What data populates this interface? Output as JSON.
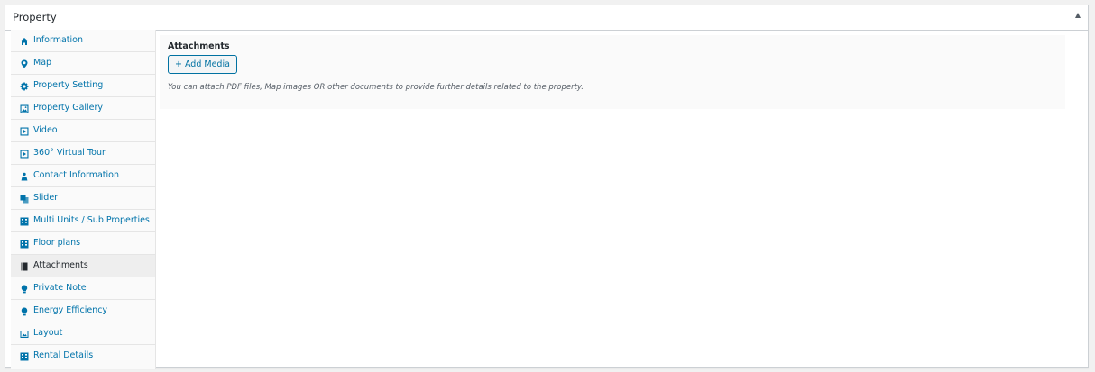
{
  "metabox": {
    "title": "Property",
    "toggle_icon": "arrow-up-icon"
  },
  "tabs": [
    {
      "label": "Information",
      "icon": "home-icon",
      "active": false
    },
    {
      "label": "Map",
      "icon": "location-pin-icon",
      "active": false
    },
    {
      "label": "Property Setting",
      "icon": "gear-icon",
      "active": false
    },
    {
      "label": "Property Gallery",
      "icon": "gallery-icon",
      "active": false
    },
    {
      "label": "Video",
      "icon": "video-icon",
      "active": false
    },
    {
      "label": "360° Virtual Tour",
      "icon": "video-icon",
      "active": false
    },
    {
      "label": "Contact Information",
      "icon": "contacts-icon",
      "active": false
    },
    {
      "label": "Slider",
      "icon": "slider-icon",
      "active": false
    },
    {
      "label": "Multi Units / Sub Properties",
      "icon": "building-icon",
      "active": false
    },
    {
      "label": "Floor plans",
      "icon": "building-icon",
      "active": false
    },
    {
      "label": "Attachments",
      "icon": "book-icon",
      "active": true
    },
    {
      "label": "Private Note",
      "icon": "lightbulb-icon",
      "active": false
    },
    {
      "label": "Energy Efficiency",
      "icon": "lightbulb-icon",
      "active": false
    },
    {
      "label": "Layout",
      "icon": "layout-icon",
      "active": false
    },
    {
      "label": "Rental Details",
      "icon": "building-icon",
      "active": false
    }
  ],
  "attachments": {
    "heading": "Attachments",
    "add_media_label": "+ Add Media",
    "description": "You can attach PDF files, Map images OR other documents to provide further details related to the property."
  },
  "colors": {
    "link": "#0073aa",
    "active_icon": "#23282d"
  }
}
